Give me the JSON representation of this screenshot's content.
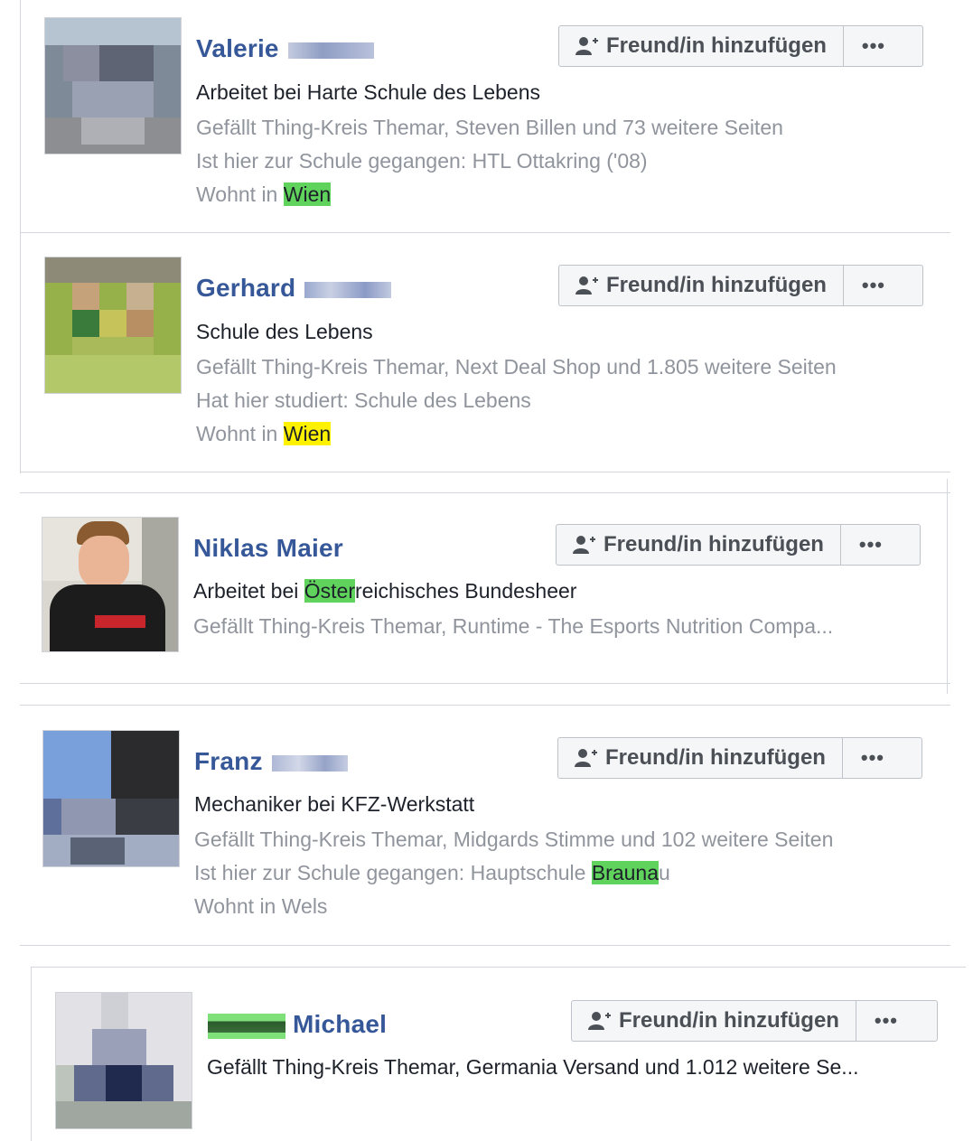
{
  "add_friend_label": "Freund/in hinzufügen",
  "more_label": "•••",
  "people": [
    {
      "first_name": "Valerie",
      "lines": [
        {
          "style": "dark",
          "parts": [
            {
              "t": "Arbeitet bei Harte Schule des Lebens"
            }
          ]
        },
        {
          "style": "grey",
          "parts": [
            {
              "t": "Gefällt Thing-Kreis Themar, Steven Billen und 73 weitere Seiten"
            }
          ]
        },
        {
          "style": "grey",
          "parts": [
            {
              "t": "Ist hier zur Schule gegangen: HTL Ottakring ('08)"
            }
          ]
        },
        {
          "style": "grey",
          "parts": [
            {
              "t": "Wohnt in "
            },
            {
              "t": "Wien",
              "hl": "green"
            }
          ]
        }
      ]
    },
    {
      "first_name": "Gerhard",
      "lines": [
        {
          "style": "dark",
          "parts": [
            {
              "t": "Schule des Lebens"
            }
          ]
        },
        {
          "style": "grey",
          "parts": [
            {
              "t": "Gefällt Thing-Kreis Themar, Next Deal Shop und 1.805 weitere Seiten"
            }
          ]
        },
        {
          "style": "grey",
          "parts": [
            {
              "t": "Hat hier studiert: Schule des Lebens"
            }
          ]
        },
        {
          "style": "grey",
          "parts": [
            {
              "t": "Wohnt in "
            },
            {
              "t": "Wien",
              "hl": "yellow"
            }
          ]
        }
      ]
    },
    {
      "first_name": "Niklas Maier",
      "lines": [
        {
          "style": "dark",
          "parts": [
            {
              "t": "Arbeitet bei "
            },
            {
              "t": "Öster",
              "hl": "green"
            },
            {
              "t": "reichisches Bundesheer"
            }
          ]
        },
        {
          "style": "grey",
          "parts": [
            {
              "t": "Gefällt Thing-Kreis Themar, Runtime - The Esports Nutrition Compa..."
            }
          ]
        }
      ]
    },
    {
      "first_name": "Franz",
      "lines": [
        {
          "style": "dark",
          "parts": [
            {
              "t": "Mechaniker bei KFZ-Werkstatt"
            }
          ]
        },
        {
          "style": "grey",
          "parts": [
            {
              "t": "Gefällt Thing-Kreis Themar, Midgards Stimme und 102 weitere Seiten"
            }
          ]
        },
        {
          "style": "grey",
          "parts": [
            {
              "t": "Ist hier zur Schule gegangen: Hauptschule "
            },
            {
              "t": "Brauna",
              "hl": "green"
            },
            {
              "t": "u"
            }
          ]
        },
        {
          "style": "grey",
          "parts": [
            {
              "t": "Wohnt in Wels"
            }
          ]
        }
      ]
    },
    {
      "first_name": "Michael",
      "lines": [
        {
          "style": "dark",
          "parts": [
            {
              "t": "Gefällt Thing-Kreis Themar, Germania Versand und 1.012 weitere Se..."
            }
          ]
        }
      ]
    }
  ]
}
